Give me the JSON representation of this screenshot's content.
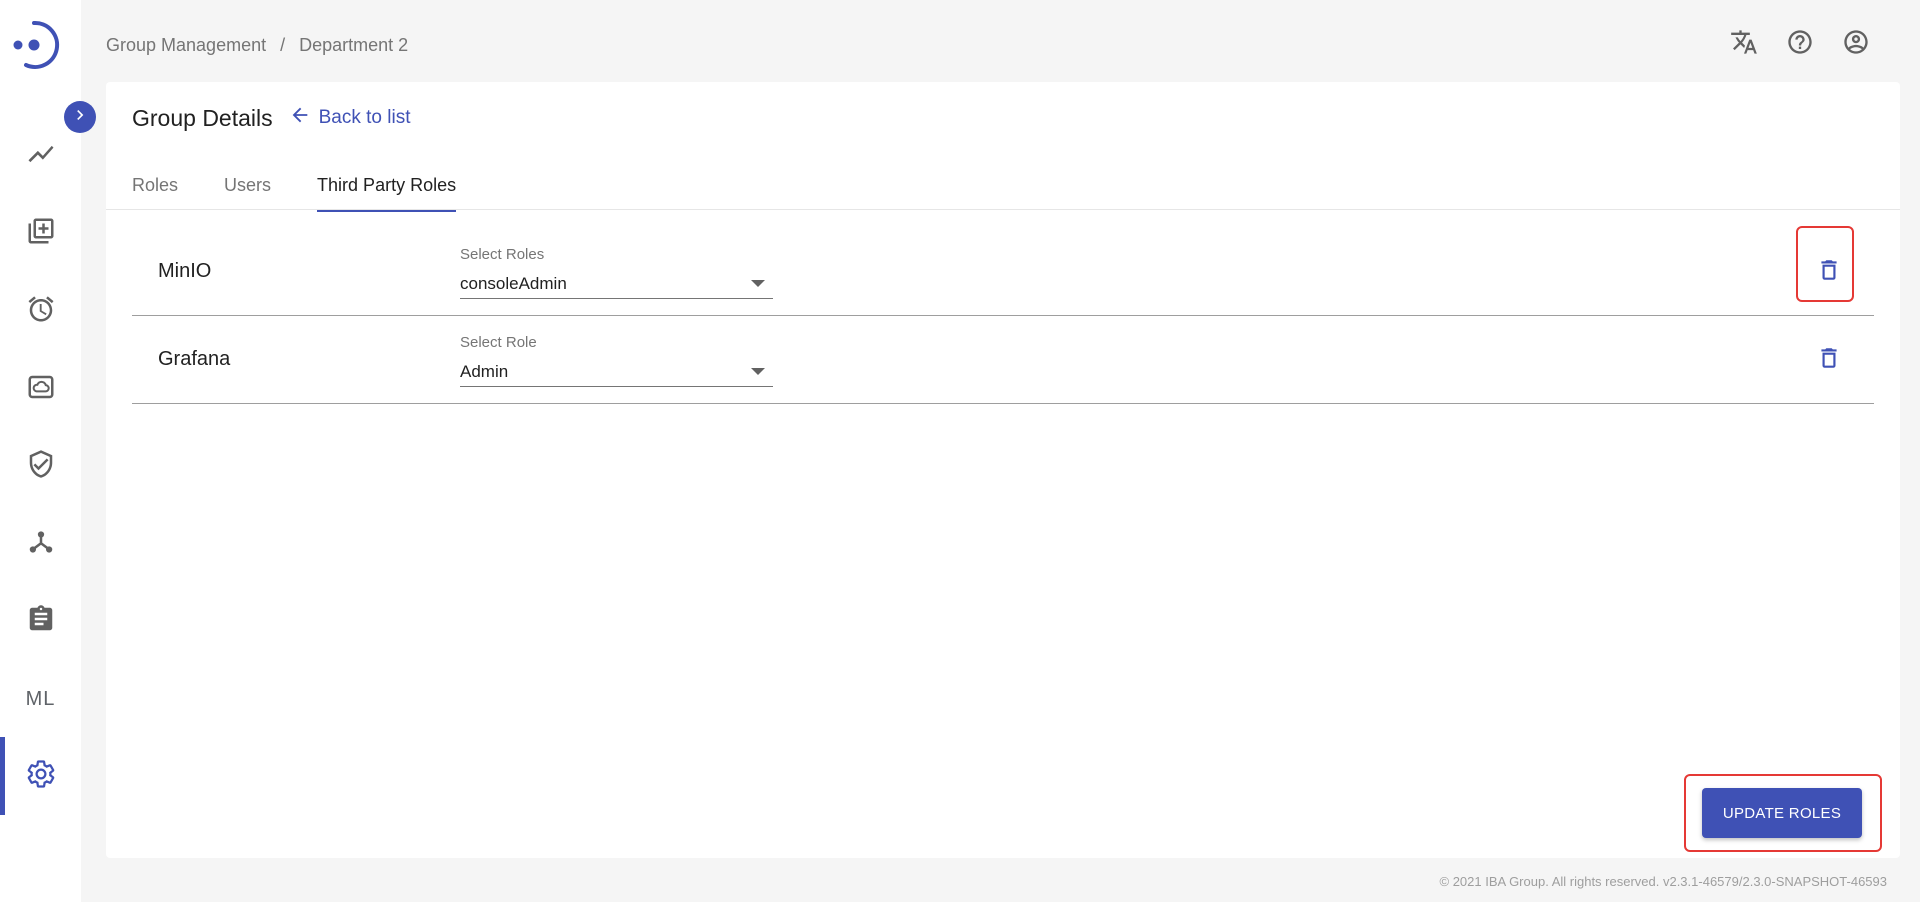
{
  "breadcrumb": {
    "parent": "Group Management",
    "separator": "/",
    "current": "Department 2"
  },
  "header": {
    "title": "Group Details",
    "back_label": "Back to list"
  },
  "tabs": [
    {
      "label": "Roles",
      "active": false
    },
    {
      "label": "Users",
      "active": false
    },
    {
      "label": "Third Party Roles",
      "active": true
    }
  ],
  "roles": [
    {
      "name": "MinIO",
      "select_label": "Select Roles",
      "value": "consoleAdmin"
    },
    {
      "name": "Grafana",
      "select_label": "Select Role",
      "value": "Admin"
    }
  ],
  "actions": {
    "update_label": "UPDATE ROLES"
  },
  "sidebar": {
    "items": [
      {
        "icon": "trend-line-icon"
      },
      {
        "icon": "add-library-icon"
      },
      {
        "icon": "alarm-clock-icon"
      },
      {
        "icon": "cloud-storage-icon"
      },
      {
        "icon": "shield-check-icon"
      },
      {
        "icon": "network-tree-icon"
      },
      {
        "icon": "clipboard-icon"
      },
      {
        "icon": "ml-text-icon",
        "label": "ML"
      },
      {
        "icon": "gear-icon",
        "active": true
      }
    ]
  },
  "footer": {
    "text": "© 2021 IBA Group. All rights reserved. v2.3.1-46579/2.3.0-SNAPSHOT-46593"
  },
  "colors": {
    "accent": "#3f51b5",
    "highlight": "#e53935",
    "background": "#f5f5f5"
  }
}
